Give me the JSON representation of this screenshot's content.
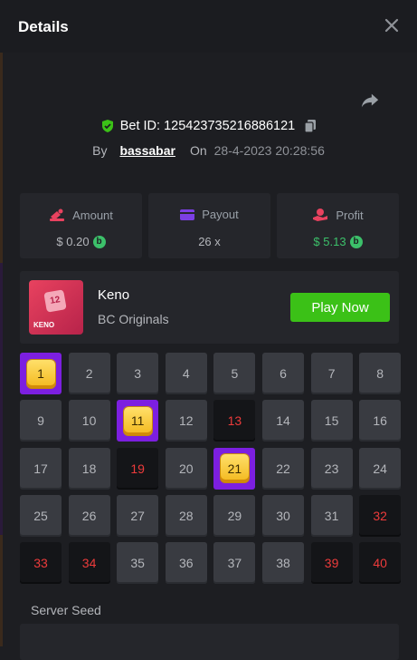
{
  "header": {
    "title": "Details"
  },
  "bet": {
    "id_label": "Bet ID: 125423735216886121",
    "by_label": "By",
    "user": "bassabar",
    "on_label": "On",
    "datetime": "28-4-2023 20:28:56"
  },
  "stats": {
    "amount": {
      "label": "Amount",
      "value": "$ 0.20",
      "color": "#e8425f"
    },
    "payout": {
      "label": "Payout",
      "value": "26 x",
      "color": "#7c3fe4"
    },
    "profit": {
      "label": "Profit",
      "value": "$ 5.13",
      "color": "#e8425f",
      "value_color": "#3cc06a"
    }
  },
  "game": {
    "thumb_number": "12",
    "thumb_text": "KENO",
    "name": "Keno",
    "provider": "BC Originals",
    "play_label": "Play Now"
  },
  "keno": {
    "numbers": [
      "1",
      "2",
      "3",
      "4",
      "5",
      "6",
      "7",
      "8",
      "9",
      "10",
      "11",
      "12",
      "13",
      "14",
      "15",
      "16",
      "17",
      "18",
      "19",
      "20",
      "21",
      "22",
      "23",
      "24",
      "25",
      "26",
      "27",
      "28",
      "29",
      "30",
      "31",
      "32",
      "33",
      "34",
      "35",
      "36",
      "37",
      "38",
      "39",
      "40"
    ],
    "hits": [
      "1",
      "11",
      "21"
    ],
    "misses": [
      "13",
      "19",
      "32",
      "33",
      "34",
      "39",
      "40"
    ]
  },
  "seed": {
    "label": "Server Seed"
  },
  "colors": {
    "accent_green": "#3bc117",
    "hit_purple": "#7c1fe0",
    "miss_red": "#ed3b3b"
  },
  "icons": [
    "close-icon",
    "share-icon",
    "shield-check-icon",
    "copy-icon",
    "coin-icon",
    "wallet-icon",
    "hand-coin-icon"
  ]
}
